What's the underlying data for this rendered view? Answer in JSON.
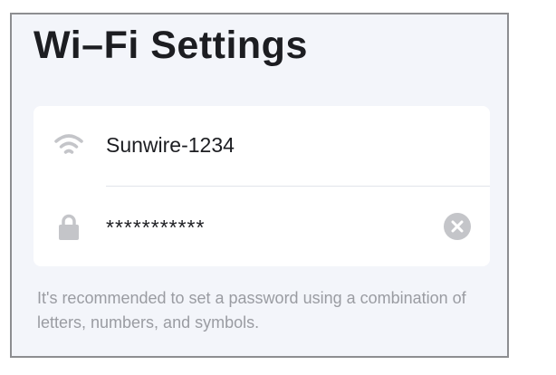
{
  "page": {
    "title": "Wi–Fi Settings"
  },
  "network": {
    "ssid": "Sunwire-1234",
    "ssid_icon": "wifi-icon",
    "password_masked": "***********",
    "password_icon": "lock-icon",
    "clear_icon": "clear-circle-icon"
  },
  "hint": {
    "text": "It's recommended to set a password using a combination of letters, numbers, and symbols."
  },
  "colors": {
    "background": "#f3f5fa",
    "card": "#ffffff",
    "text": "#1c1d21",
    "icon": "#c4c5c9",
    "hint": "#9a9ca2"
  }
}
